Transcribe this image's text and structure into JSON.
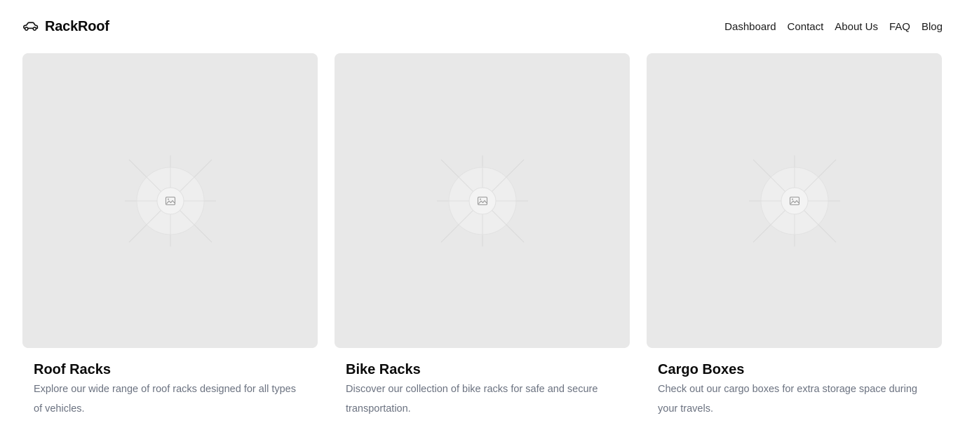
{
  "brand": {
    "name": "RackRoof",
    "icon": "car-icon"
  },
  "nav": {
    "items": [
      {
        "label": "Dashboard"
      },
      {
        "label": "Contact"
      },
      {
        "label": "About Us"
      },
      {
        "label": "FAQ"
      },
      {
        "label": "Blog"
      }
    ]
  },
  "cards": [
    {
      "title": "Roof Racks",
      "description": "Explore our wide range of roof racks designed for all types of vehicles.",
      "image_icon": "image-placeholder-icon"
    },
    {
      "title": "Bike Racks",
      "description": "Discover our collection of bike racks for safe and secure transportation.",
      "image_icon": "image-placeholder-icon"
    },
    {
      "title": "Cargo Boxes",
      "description": "Check out our cargo boxes for extra storage space during your travels.",
      "image_icon": "image-placeholder-icon"
    }
  ],
  "colors": {
    "image_background": "#e8e8e8",
    "description_text": "#6b7280",
    "heading_text": "#0a0a0a"
  }
}
